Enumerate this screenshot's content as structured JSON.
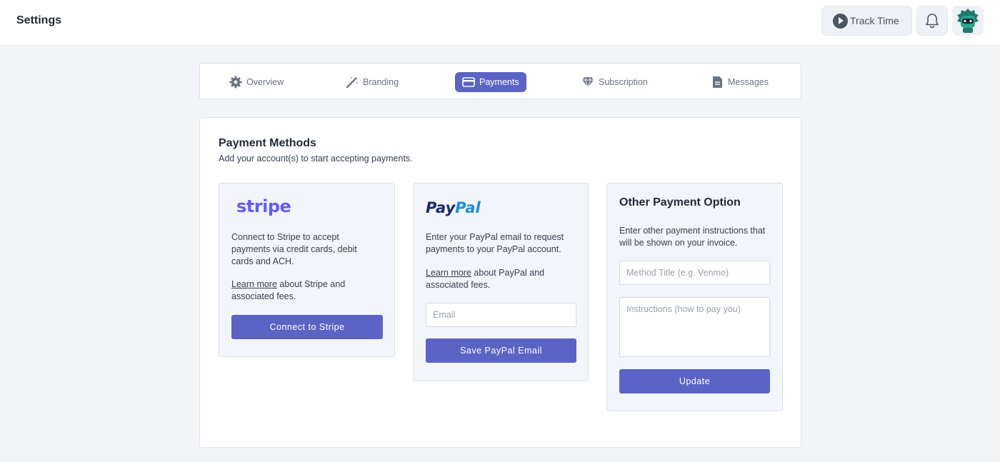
{
  "header": {
    "title": "Settings",
    "track_time_label": "Track Time"
  },
  "tabs": [
    {
      "label": "Overview",
      "icon": "gear-icon",
      "active": false
    },
    {
      "label": "Branding",
      "icon": "magic-wand-icon",
      "active": false
    },
    {
      "label": "Payments",
      "icon": "credit-card-icon",
      "active": true
    },
    {
      "label": "Subscription",
      "icon": "diamond-icon",
      "active": false
    },
    {
      "label": "Messages",
      "icon": "document-icon",
      "active": false
    }
  ],
  "payment_methods": {
    "title": "Payment Methods",
    "subtitle": "Add your account(s) to start accepting payments."
  },
  "stripe": {
    "logo_text": "stripe",
    "description": "Connect to Stripe to accept payments via credit cards, debit cards and ACH.",
    "learn_more_link": "Learn more",
    "learn_more_suffix": " about Stripe and associated fees.",
    "button_label": "Connect to Stripe"
  },
  "paypal": {
    "logo_pay": "Pay",
    "logo_pal": "Pal",
    "description": "Enter your PayPal email to request payments to your PayPal account.",
    "learn_more_link": "Learn more",
    "learn_more_suffix": " about PayPal and associated fees.",
    "email_placeholder": "Email",
    "button_label": "Save PayPal Email"
  },
  "other": {
    "title": "Other Payment Option",
    "description": "Enter other payment instructions that will be shown on your invoice.",
    "method_title_placeholder": "Method Title (e.g. Venmo)",
    "instructions_placeholder": "Instructions (how to pay you)",
    "button_label": "Update"
  },
  "colors": {
    "accent": "#5b63c4",
    "stripe_brand": "#635bff",
    "paypal_dark": "#1a2a6c",
    "paypal_light": "#1f8ed6"
  }
}
